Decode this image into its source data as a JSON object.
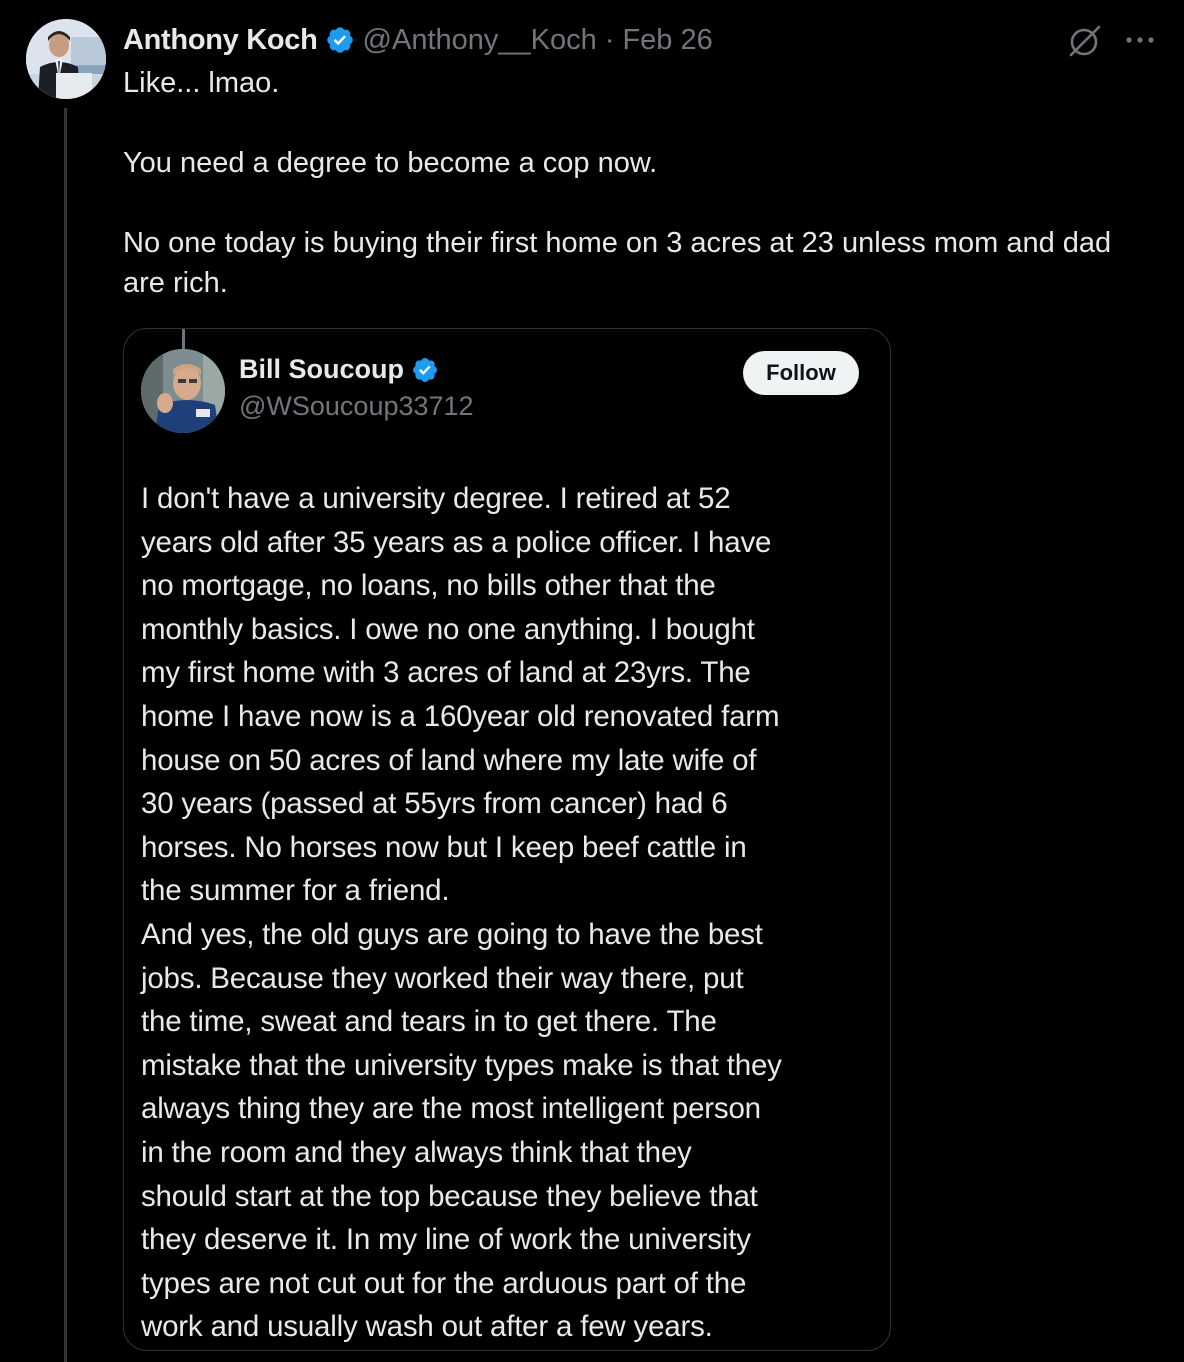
{
  "tweet": {
    "author_name": "Anthony Koch",
    "handle": "@Anthony__Koch",
    "separator": "·",
    "date": "Feb 26",
    "paragraphs": [
      "Like... lmao.",
      "You need a degree to become a cop now.",
      "No one today is buying their first home on 3 acres at 23 unless mom and dad are rich."
    ]
  },
  "quote": {
    "author_name": "Bill Soucoup",
    "handle": "@WSoucoup33712",
    "follow_label": "Follow",
    "lines": [
      "I don't have a university degree.  I retired at 52",
      "years old after 35 years as a police officer.  I have",
      "no mortgage, no loans, no bills other that the",
      "monthly basics.  I owe no one anything.  I bought",
      "my first home with 3 acres of land at 23yrs.  The",
      "home I have now is a 160year old renovated farm",
      "house on 50 acres of land where my late wife of",
      "30 years (passed at 55yrs from cancer) had 6",
      "horses.  No horses now but I keep beef cattle in",
      "the summer for a friend.",
      "And yes, the old guys are going to have the best",
      "jobs.  Because they worked their way there, put",
      "the time, sweat and tears in to get there. The",
      "mistake that the university types make is that they",
      "always thing they are the most intelligent person",
      "in the room and they always think that they",
      "should start at the top because they believe that",
      "they deserve it.  In my line of work the university",
      "types are not cut out for the arduous part of the",
      "work and usually wash out after a few years."
    ]
  },
  "icons": {
    "verified": "verified-badge-icon",
    "grok": "grok-icon",
    "more": "more-options-icon"
  },
  "colors": {
    "background": "#000000",
    "text_primary": "#e7e9ea",
    "text_secondary": "#71767b",
    "verified_blue": "#1d9bf0",
    "border": "#2f3336",
    "follow_bg": "#eff3f4"
  }
}
